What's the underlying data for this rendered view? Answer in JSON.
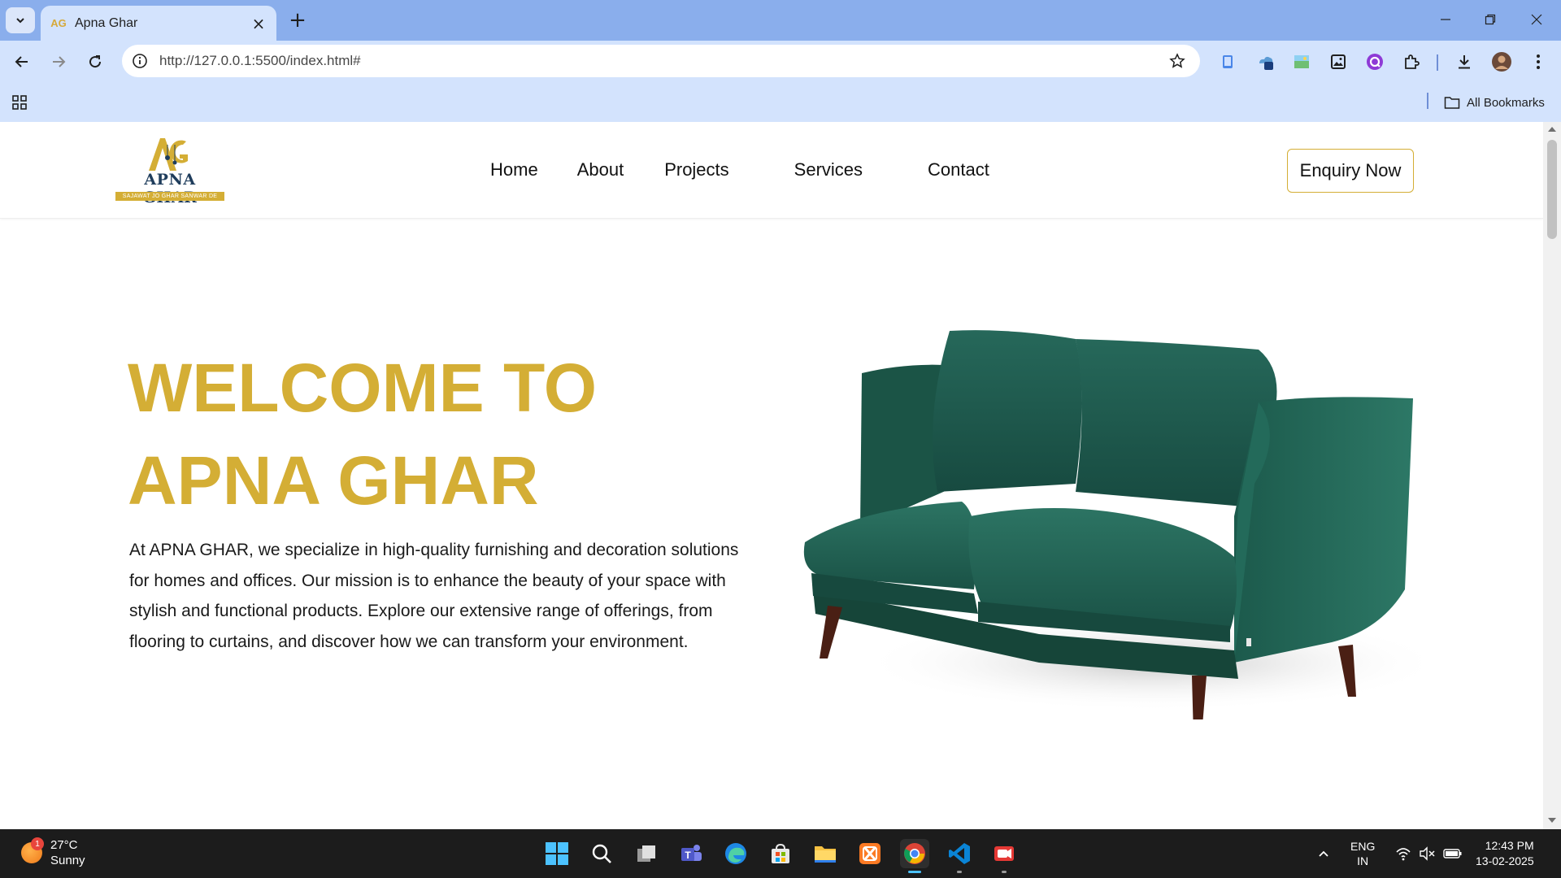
{
  "browser": {
    "tab_title": "Apna Ghar",
    "url": "http://127.0.0.1:5500/index.html#",
    "bookmarks_label": "All Bookmarks"
  },
  "site": {
    "logo": {
      "monogram": "AG",
      "name": "APNA GHAR",
      "tagline": "SAJAWAT JO GHAR SANWAR DE"
    },
    "nav": [
      "Home",
      "About",
      "Projects",
      "Services",
      "Contact"
    ],
    "cta_label": "Enquiry Now",
    "hero": {
      "title_line1": "WELCOME TO",
      "title_line2": "APNA GHAR",
      "paragraph": "At APNA GHAR, we specialize in high-quality furnishing and decoration solutions for homes and offices. Our mission is to enhance the beauty of your space with stylish and functional products. Explore our extensive range of offerings, from flooring to curtains, and discover how we can transform your environment."
    },
    "colors": {
      "gold": "#d4ae35",
      "navy": "#1f3d5c",
      "sofa_green": "#1f5a4e"
    }
  },
  "taskbar": {
    "weather_temp": "27°C",
    "weather_desc": "Sunny",
    "weather_badge": "1",
    "lang_line1": "ENG",
    "lang_line2": "IN",
    "time": "12:43 PM",
    "date": "13-02-2025"
  }
}
